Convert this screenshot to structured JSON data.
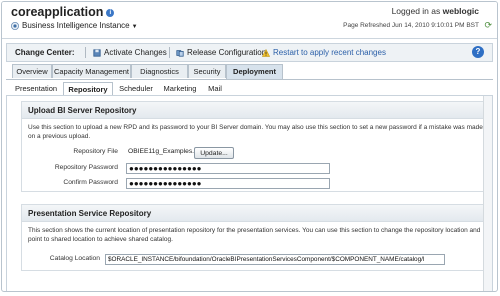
{
  "header": {
    "app_title": "coreapplication",
    "bi_instance": "Business Intelligence Instance",
    "logged_in_prefix": "Logged in as",
    "logged_in_user": "weblogic",
    "page_refreshed": "Page Refreshed Jun 14, 2010 9:10:01 PM BST"
  },
  "change_center": {
    "label": "Change Center:",
    "activate": "Activate Changes",
    "release": "Release Configuration",
    "restart_msg": "Restart to apply recent changes"
  },
  "main_tabs": [
    "Overview",
    "Capacity Management",
    "Diagnostics",
    "Security",
    "Deployment"
  ],
  "sub_tabs": [
    "Presentation",
    "Repository",
    "Scheduler",
    "Marketing",
    "Mail"
  ],
  "upload": {
    "title": "Upload BI Server Repository",
    "desc": "Use this section to upload a new RPD and its password to your BI Server domain. You may also use this section to set a new password if a mistake was made on a previous upload.",
    "repo_file_label": "Repository File",
    "repo_file_value": "OBIEE11g_Examples.rpd",
    "update_button": "Update...",
    "password_label": "Repository Password",
    "password_value": "●●●●●●●●●●●●●●●",
    "confirm_label": "Confirm Password",
    "confirm_value": "●●●●●●●●●●●●●●●"
  },
  "presentation": {
    "title": "Presentation Service Repository",
    "desc": "This section shows the current location of presentation repository for the presentation services. You can use this section to change the repository location and point to shared location to achieve shared catalog.",
    "catalog_label": "Catalog Location",
    "catalog_value": "$ORACLE_INSTANCE/bifoundation/OracleBIPresentationServicesComponent/$COMPONENT_NAME/catalog/l"
  },
  "icons": {
    "info": "info-icon",
    "refresh": "refresh-icon",
    "activate": "activate-changes-icon",
    "release": "release-configuration-icon",
    "warning": "warning-icon",
    "help": "help-icon"
  }
}
